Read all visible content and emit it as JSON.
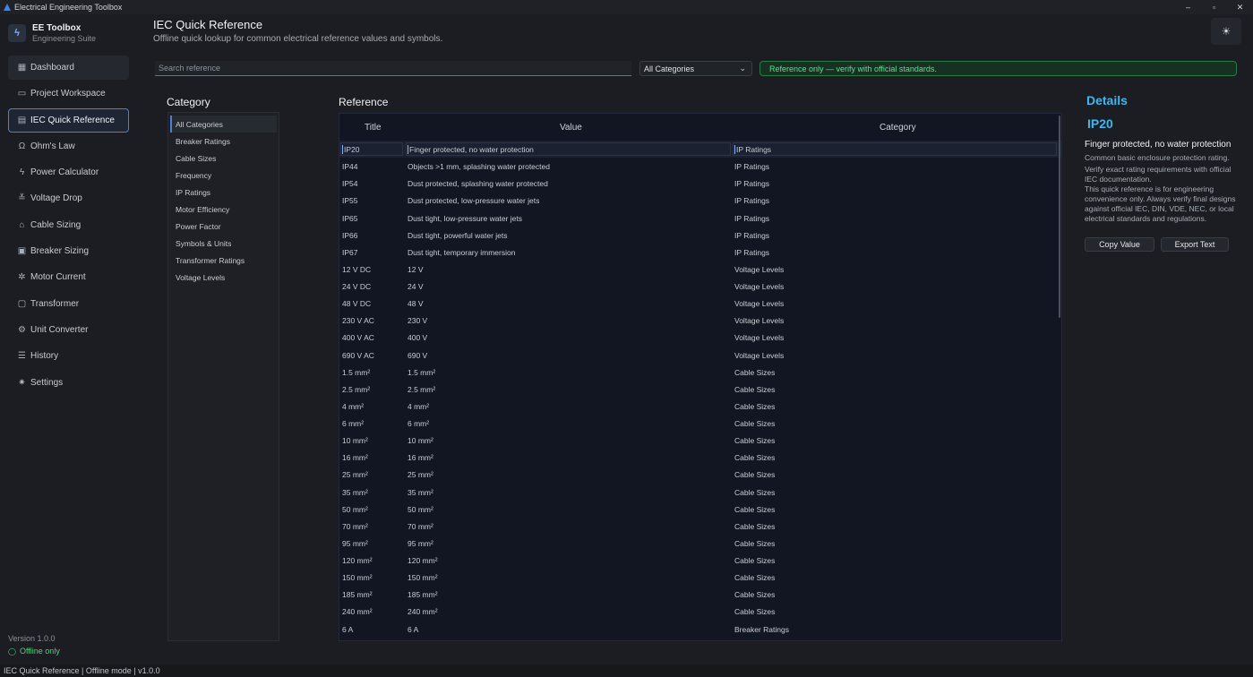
{
  "window": {
    "title": "Electrical Engineering Toolbox",
    "controls": [
      "–",
      "▫",
      "✕"
    ]
  },
  "brand": {
    "name": "EE Toolbox",
    "subtitle": "Engineering Suite"
  },
  "nav": [
    {
      "label": "Dashboard",
      "icon": "grid-icon",
      "glyph": "▦"
    },
    {
      "label": "Project Workspace",
      "icon": "folder-icon",
      "glyph": "▭"
    },
    {
      "label": "IEC Quick Reference",
      "icon": "book-icon",
      "glyph": "▤"
    },
    {
      "label": "Ohm's Law",
      "icon": "omega-icon",
      "glyph": "Ω"
    },
    {
      "label": "Power Calculator",
      "icon": "bolt-icon",
      "glyph": "ϟ"
    },
    {
      "label": "Voltage Drop",
      "icon": "voltage-icon",
      "glyph": "≚"
    },
    {
      "label": "Cable Sizing",
      "icon": "cable-icon",
      "glyph": "⌂"
    },
    {
      "label": "Breaker Sizing",
      "icon": "breaker-icon",
      "glyph": "▣"
    },
    {
      "label": "Motor Current",
      "icon": "motor-icon",
      "glyph": "✲"
    },
    {
      "label": "Transformer",
      "icon": "transformer-icon",
      "glyph": "▢"
    },
    {
      "label": "Unit Converter",
      "icon": "converter-icon",
      "glyph": "⚙"
    },
    {
      "label": "History",
      "icon": "history-icon",
      "glyph": "☰"
    },
    {
      "label": "Settings",
      "icon": "gear-icon",
      "glyph": "✷"
    }
  ],
  "sidebar_footer": {
    "version": "Version 1.0.0",
    "offline": "Offline only"
  },
  "page": {
    "title": "IEC Quick Reference",
    "subtitle": "Offline quick lookup for common electrical reference values and symbols."
  },
  "toolbar": {
    "search_placeholder": "Search reference",
    "category_selected": "All Categories",
    "notice": "Reference only — verify with official standards."
  },
  "category_panel": {
    "title": "Category",
    "items": [
      "All Categories",
      "Breaker Ratings",
      "Cable Sizes",
      "Frequency",
      "IP Ratings",
      "Motor Efficiency",
      "Power Factor",
      "Symbols & Units",
      "Transformer Ratings",
      "Voltage Levels"
    ]
  },
  "reference": {
    "title": "Reference",
    "columns": [
      "Title",
      "Value",
      "Category"
    ],
    "rows": [
      [
        "IP20",
        "Finger protected, no water protection",
        "IP Ratings"
      ],
      [
        "IP44",
        "Objects >1 mm, splashing water protected",
        "IP Ratings"
      ],
      [
        "IP54",
        "Dust protected, splashing water protected",
        "IP Ratings"
      ],
      [
        "IP55",
        "Dust protected, low-pressure water jets",
        "IP Ratings"
      ],
      [
        "IP65",
        "Dust tight, low-pressure water jets",
        "IP Ratings"
      ],
      [
        "IP66",
        "Dust tight, powerful water jets",
        "IP Ratings"
      ],
      [
        "IP67",
        "Dust tight, temporary immersion",
        "IP Ratings"
      ],
      [
        "12 V DC",
        "12 V",
        "Voltage Levels"
      ],
      [
        "24 V DC",
        "24 V",
        "Voltage Levels"
      ],
      [
        "48 V DC",
        "48 V",
        "Voltage Levels"
      ],
      [
        "230 V AC",
        "230 V",
        "Voltage Levels"
      ],
      [
        "400 V AC",
        "400 V",
        "Voltage Levels"
      ],
      [
        "690 V AC",
        "690 V",
        "Voltage Levels"
      ],
      [
        "1.5 mm²",
        "1.5 mm²",
        "Cable Sizes"
      ],
      [
        "2.5 mm²",
        "2.5 mm²",
        "Cable Sizes"
      ],
      [
        "4 mm²",
        "4 mm²",
        "Cable Sizes"
      ],
      [
        "6 mm²",
        "6 mm²",
        "Cable Sizes"
      ],
      [
        "10 mm²",
        "10 mm²",
        "Cable Sizes"
      ],
      [
        "16 mm²",
        "16 mm²",
        "Cable Sizes"
      ],
      [
        "25 mm²",
        "25 mm²",
        "Cable Sizes"
      ],
      [
        "35 mm²",
        "35 mm²",
        "Cable Sizes"
      ],
      [
        "50 mm²",
        "50 mm²",
        "Cable Sizes"
      ],
      [
        "70 mm²",
        "70 mm²",
        "Cable Sizes"
      ],
      [
        "95 mm²",
        "95 mm²",
        "Cable Sizes"
      ],
      [
        "120 mm²",
        "120 mm²",
        "Cable Sizes"
      ],
      [
        "150 mm²",
        "150 mm²",
        "Cable Sizes"
      ],
      [
        "185 mm²",
        "185 mm²",
        "Cable Sizes"
      ],
      [
        "240 mm²",
        "240 mm²",
        "Cable Sizes"
      ],
      [
        "6 A",
        "6 A",
        "Breaker Ratings"
      ]
    ]
  },
  "details": {
    "title": "Details",
    "code": "IP20",
    "value": "Finger protected, no water protection",
    "description": "Common basic enclosure protection rating.",
    "note": "Verify exact rating requirements with official IEC documentation.\nThis quick reference is for engineering convenience only. Always verify final designs against official IEC, DIN, VDE, NEC, or local electrical standards and regulations.",
    "copy_label": "Copy Value",
    "export_label": "Export Text"
  },
  "statusbar": {
    "text": "IEC Quick Reference  |  Offline mode  |  v1.0.0"
  },
  "colors": {
    "accent": "#3fb6f0",
    "active_border": "#4b7fd1",
    "notice_green": "#5de08c"
  }
}
